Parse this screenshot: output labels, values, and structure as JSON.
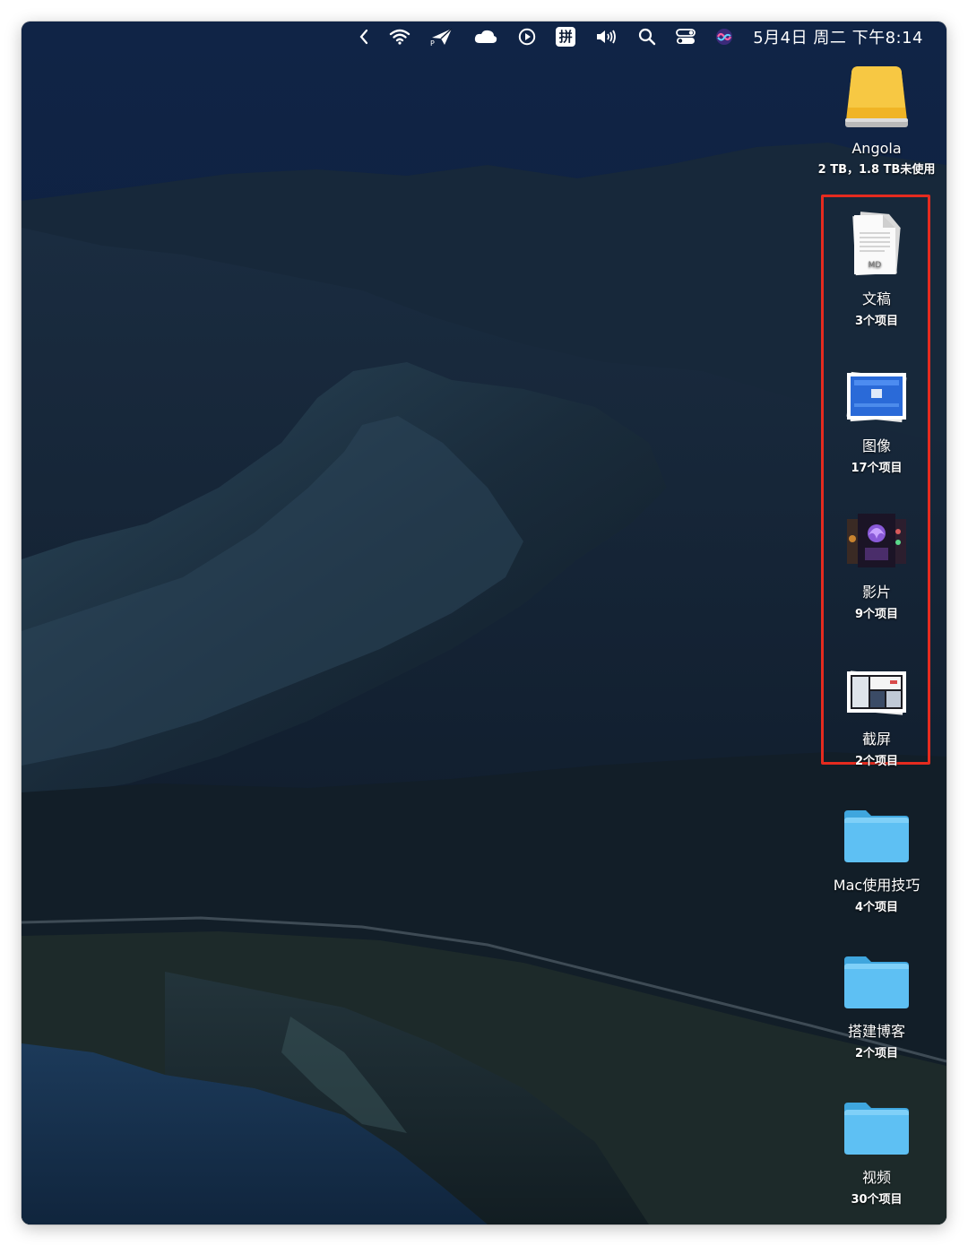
{
  "menubar": {
    "icons": [
      "chevron-left-icon",
      "wifi-icon",
      "paper-plane-icon",
      "cloud-icon",
      "play-circle-icon",
      "input-method-icon",
      "volume-icon",
      "search-icon",
      "control-center-icon",
      "siri-icon"
    ],
    "input_method_label": "拼",
    "clock": "5月4日 周二 下午8:14"
  },
  "desktop": {
    "drive": {
      "name": "Angola",
      "sub": "2 TB，1.8 TB未使用",
      "icon": "external-drive-icon"
    },
    "stacks": [
      {
        "name": "文稿",
        "sub": "3个项目",
        "icon": "document-stack-icon",
        "badge": "MD"
      },
      {
        "name": "图像",
        "sub": "17个项目",
        "icon": "image-stack-icon"
      },
      {
        "name": "影片",
        "sub": "9个项目",
        "icon": "movie-stack-icon"
      },
      {
        "name": "截屏",
        "sub": "2个项目",
        "icon": "screenshot-stack-icon"
      }
    ],
    "folders": [
      {
        "name": "Mac使用技巧",
        "sub": "4个项目",
        "icon": "folder-icon"
      },
      {
        "name": "搭建博客",
        "sub": "2个项目",
        "icon": "folder-icon"
      },
      {
        "name": "视频",
        "sub": "30个项目",
        "icon": "folder-icon"
      }
    ]
  },
  "colors": {
    "highlight": "#e52b1f",
    "folder": "#5ec0f3",
    "drive": "#e8a91a"
  }
}
